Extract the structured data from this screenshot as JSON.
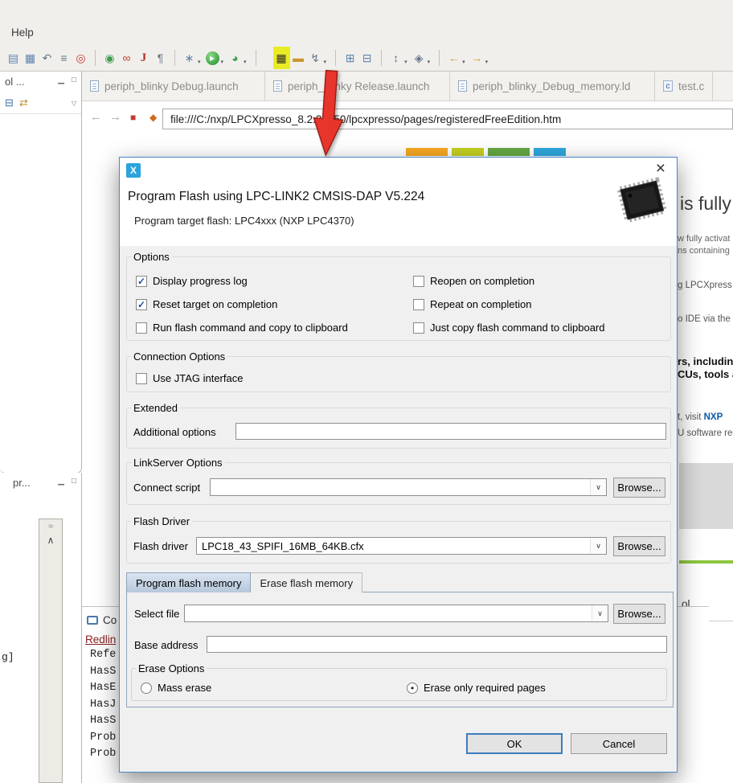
{
  "colors": {
    "highlight_yellow": "#e9eb24",
    "arrow_red": "#e8352c",
    "dialog_border": "#4a86c8",
    "brand_blue": "#2ba3dc",
    "console_link": "#8b2020"
  },
  "glyphs": {
    "caret": "▾",
    "chevron_down": "∨",
    "check": "✓",
    "radio_dot": "●",
    "minimize": "▁",
    "maximize": "□",
    "close": "×",
    "panel_dropdown": "▽",
    "collapse": "≈",
    "up": "∧",
    "back": "←",
    "forward": "→",
    "stop": "■",
    "spark": "◆",
    "collapse_all": "⊟",
    "link_editor": "⇄"
  },
  "menubar": {
    "help_label": "Help"
  },
  "toolbar": {
    "icons": [
      {
        "name": "save-icon",
        "glyph": "▤"
      },
      {
        "name": "save-all-icon",
        "glyph": "▦"
      },
      {
        "name": "undo-icon",
        "glyph": "↶"
      },
      {
        "name": "build-icon",
        "glyph": "≡"
      },
      {
        "name": "debug-target-icon",
        "glyph": "◎"
      },
      {
        "name": "java-bean-icon",
        "glyph": "◉"
      },
      {
        "name": "link-chain-icon",
        "glyph": "∞"
      },
      {
        "name": "java-launch-icon",
        "glyph": "J"
      },
      {
        "name": "whitespace-icon",
        "glyph": "¶"
      },
      {
        "name": "new-wizard-icon",
        "glyph": "∗"
      },
      {
        "name": "run-icon",
        "glyph": "▶"
      },
      {
        "name": "profile-icon",
        "glyph": "◕"
      },
      {
        "name": "program-flash-icon",
        "glyph": "▦"
      },
      {
        "name": "open-folder-icon",
        "glyph": "▬"
      },
      {
        "name": "external-tools-icon",
        "glyph": "↯"
      },
      {
        "name": "table-icon",
        "glyph": "⊞"
      },
      {
        "name": "grid-icon",
        "glyph": "⊟"
      },
      {
        "name": "sort-icon",
        "glyph": "↕"
      },
      {
        "name": "mark-occurrences-icon",
        "glyph": "◈"
      },
      {
        "name": "back-history-icon",
        "glyph": "←"
      },
      {
        "name": "forward-history-icon",
        "glyph": "→"
      }
    ]
  },
  "editor_tabs": {
    "tabs": [
      {
        "label": "periph_blinky Debug.launch"
      },
      {
        "label": "periph_blinky Release.launch"
      },
      {
        "label": "periph_blinky_Debug_memory.ld"
      },
      {
        "label": "test.c"
      }
    ],
    "c_badge": "c"
  },
  "address_bar": {
    "url": "file:///C:/nxp/LPCXpresso_8.2.2_650/lpcxpresso/pages/registeredFreeEdition.htm"
  },
  "left_panels": {
    "panel1_title": "ol ...",
    "panel2_title": "pr...",
    "gutter_text": "g]"
  },
  "console": {
    "title": "Co",
    "tab_label": "Redlin",
    "lines": [
      "Refe",
      "HasS",
      "HasE",
      "HasJ",
      "HasS",
      "Prob",
      "Prob"
    ]
  },
  "page": {
    "headline": "is fully",
    "line1": "w fully activat",
    "line2": "ns containing",
    "line3": "g LPCXpress",
    "line4": "o IDE via the",
    "bold1": "rs, including",
    "bold2": "CUs, tools a",
    "visit_prefix": "t, visit ",
    "visit_brand": "NXP",
    "line5": "U software re",
    "tool_text": "ol"
  },
  "dialog": {
    "app_icon": "X",
    "title": "Program Flash using LPC-LINK2 CMSIS-DAP V5.224",
    "subtitle": "Program target flash: LPC4xxx (NXP LPC4370)",
    "options": {
      "legend": "Options",
      "items": [
        {
          "label": "Display progress log",
          "checked": true,
          "mark": "✓"
        },
        {
          "label": "Reopen on completion",
          "checked": false,
          "mark": ""
        },
        {
          "label": "Reset target on completion",
          "checked": true,
          "mark": "✓"
        },
        {
          "label": "Repeat on completion",
          "checked": false,
          "mark": ""
        },
        {
          "label": "Run flash command and copy to clipboard",
          "checked": false,
          "mark": ""
        },
        {
          "label": "Just copy flash command to clipboard",
          "checked": false,
          "mark": ""
        }
      ]
    },
    "connection": {
      "legend": "Connection Options",
      "jtag": {
        "label": "Use JTAG interface",
        "checked": false,
        "mark": ""
      }
    },
    "extended": {
      "legend": "Extended",
      "additional_label": "Additional options",
      "additional_value": ""
    },
    "linkserver": {
      "legend": "LinkServer Options",
      "connect_label": "Connect script",
      "connect_value": "",
      "browse_label": "Browse..."
    },
    "flash_driver": {
      "legend": "Flash Driver",
      "label": "Flash driver",
      "value": "LPC18_43_SPIFI_16MB_64KB.cfx",
      "browse_label": "Browse..."
    },
    "tabs": [
      {
        "label": "Program flash memory",
        "selected": true
      },
      {
        "label": "Erase flash memory",
        "selected": false
      }
    ],
    "program_tab": {
      "select_file_label": "Select file",
      "select_file_value": "",
      "browse_label": "Browse...",
      "base_address_label": "Base address",
      "base_address_value": "",
      "erase": {
        "legend": "Erase Options",
        "options": [
          {
            "label": "Mass erase",
            "selected": false,
            "dot": ""
          },
          {
            "label": "Erase only required pages",
            "selected": true,
            "dot": "●"
          }
        ]
      }
    },
    "buttons": {
      "ok": "OK",
      "cancel": "Cancel"
    }
  }
}
